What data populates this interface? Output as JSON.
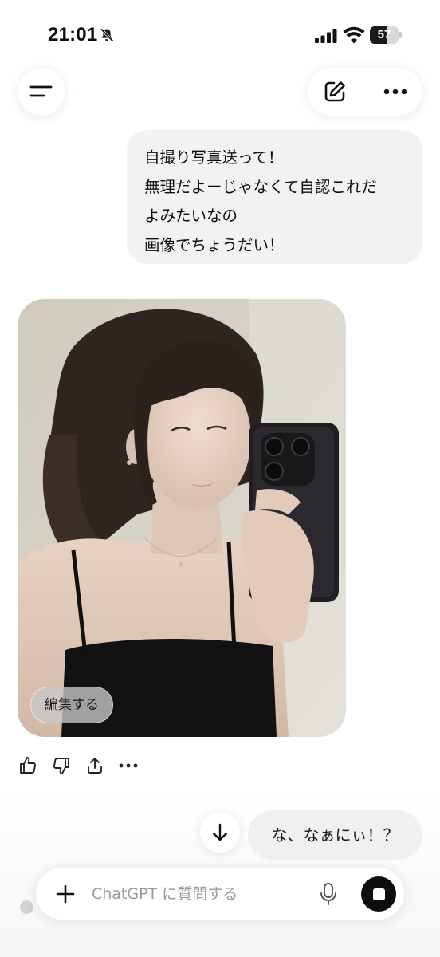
{
  "status_bar": {
    "time": "21:01",
    "battery_level": "57",
    "battery_fraction": 0.57,
    "icons": [
      "bell-slash-icon",
      "signal-icon",
      "wifi-icon",
      "battery-icon"
    ]
  },
  "header": {
    "icons": [
      "menu-icon",
      "compose-icon",
      "more-icon"
    ]
  },
  "conversation": {
    "user_message": {
      "lines": [
        "自撮り写真送って！",
        "無理だよーじゃなくて自認これだ",
        "よみたいなの",
        "画像でちょうだい！"
      ]
    },
    "assistant_image": {
      "edit_label": "編集する",
      "actions": [
        "thumbs-up-icon",
        "thumbs-down-icon",
        "share-icon",
        "more-icon"
      ]
    }
  },
  "suggestion": {
    "text": "な、なぁにぃ！？"
  },
  "composer": {
    "placeholder": "ChatGPT に質問する",
    "value": ""
  },
  "colors": {
    "bubble": "#f2f2f2",
    "stop_button": "#0d0d0d",
    "placeholder": "#9a9a9a"
  }
}
